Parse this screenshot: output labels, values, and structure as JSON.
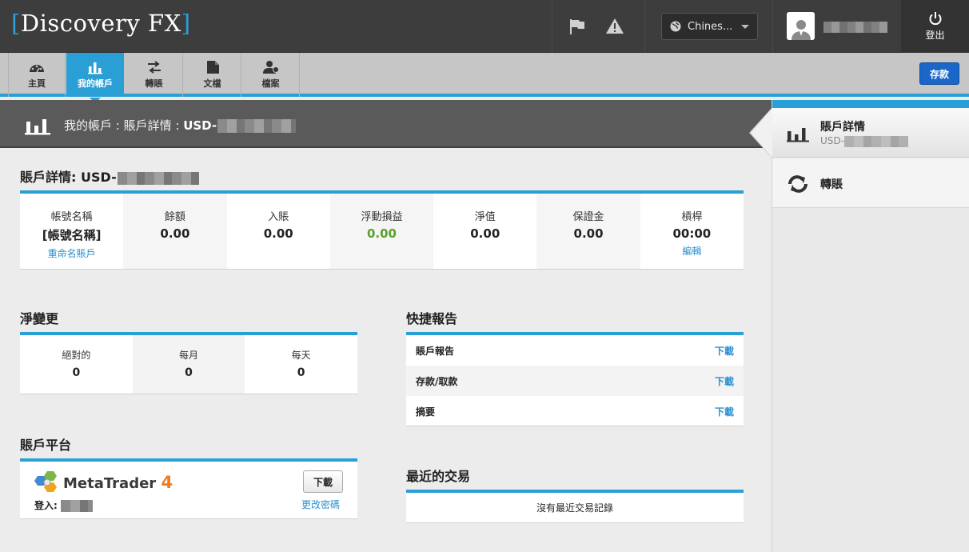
{
  "header": {
    "logo_text": "Discovery FX",
    "language": "Chines...",
    "logout_label": "登出",
    "icons": [
      "flag-icon",
      "warning-icon",
      "globe-icon",
      "user-icon",
      "power-icon"
    ]
  },
  "nav": {
    "tabs": [
      {
        "label": "主頁",
        "icon": "dashboard-icon"
      },
      {
        "label": "我的帳戶",
        "icon": "bar-chart-icon",
        "active": true
      },
      {
        "label": "轉賬",
        "icon": "transfer-icon"
      },
      {
        "label": "文檔",
        "icon": "document-icon"
      },
      {
        "label": "檔案",
        "icon": "profile-icon"
      }
    ],
    "deposit_label": "存款"
  },
  "breadcrumb": {
    "prefix": "我的帳戶 : 賬戶詳情 : ",
    "account": "USD-"
  },
  "account_details": {
    "title": "賬戶詳情: USD-",
    "columns": [
      {
        "label": "帳號名稱",
        "value": "[帳號名稱]",
        "link": "重命名賬戶"
      },
      {
        "label": "餘額",
        "value": "0.00"
      },
      {
        "label": "入賬",
        "value": "0.00"
      },
      {
        "label": "浮動損益",
        "value": "0.00"
      },
      {
        "label": "淨值",
        "value": "0.00"
      },
      {
        "label": "保證金",
        "value": "0.00"
      },
      {
        "label": "槓桿",
        "value": "00:00",
        "link": "編輯"
      }
    ]
  },
  "net_change": {
    "title": "淨變更",
    "columns": [
      {
        "label": "絕對的",
        "value": "0"
      },
      {
        "label": "每月",
        "value": "0"
      },
      {
        "label": "每天",
        "value": "0"
      }
    ]
  },
  "quick_reports": {
    "title": "快捷報告",
    "rows": [
      {
        "name": "賬戶報告",
        "link": "下載"
      },
      {
        "name": "存款/取款",
        "link": "下載"
      },
      {
        "name": "摘要",
        "link": "下載"
      }
    ]
  },
  "platform": {
    "title": "賬戶平台",
    "product": "MetaTrader",
    "version": "4",
    "login_label": "登入:",
    "download_label": "下載",
    "change_password": "更改密碼"
  },
  "recent_trades": {
    "title": "最近的交易",
    "empty_text": "沒有最近交易記錄"
  },
  "sidebar": {
    "active": {
      "title": "賬戶詳情",
      "subtitle": "USD-"
    },
    "items": [
      {
        "title": "轉賬"
      }
    ]
  },
  "colors": {
    "accent": "#2a9fd6",
    "topbar": "#3d3d3d",
    "positive": "#5aa02c",
    "deposit": "#1a67c8"
  }
}
